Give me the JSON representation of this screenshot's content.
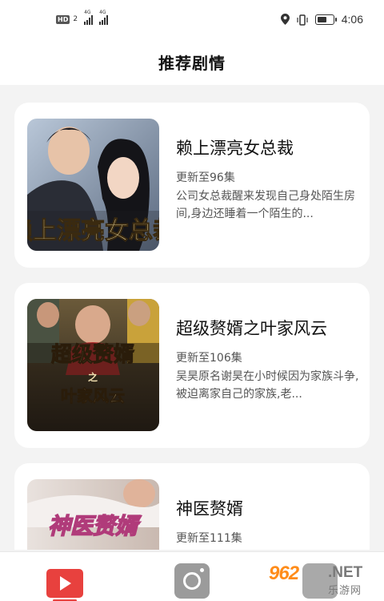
{
  "status_bar": {
    "hd_label": "HD",
    "sim_number": "2",
    "network_1": "4G",
    "network_2": "4G",
    "time": "4:06",
    "battery_level": 0.6
  },
  "header": {
    "title": "推荐剧情"
  },
  "dramas": [
    {
      "title": "赖上漂亮女总裁",
      "episodes": "更新至96集",
      "description": "公司女总裁醒来发现自己身处陌生房间,身边还睡着一个陌生的...",
      "poster_text": "赖上漂亮女总裁"
    },
    {
      "title": "超级赘婿之叶家风云",
      "episodes": "更新至106集",
      "description": "吴昊原名谢昊在小时候因为家族斗争,被迫离家自己的家族,老...",
      "poster_text_1": "超级赘婿",
      "poster_text_2": "之",
      "poster_text_3": "叶家风云"
    },
    {
      "title": "神医赘婿",
      "episodes": "更新至111集",
      "description": "",
      "poster_text": "神医赘婿"
    }
  ],
  "tabs": [
    {
      "icon": "play-video-icon",
      "active": true
    },
    {
      "icon": "camera-icon",
      "active": false
    },
    {
      "icon": "profile-icon",
      "active": false
    }
  ],
  "watermark": {
    "logo": "962",
    "net": ".NET",
    "sub": "乐游网"
  },
  "colors": {
    "accent": "#e8413e",
    "card_bg": "#ffffff",
    "page_bg": "#f3f3f3",
    "watermark": "#ff8c1a"
  }
}
